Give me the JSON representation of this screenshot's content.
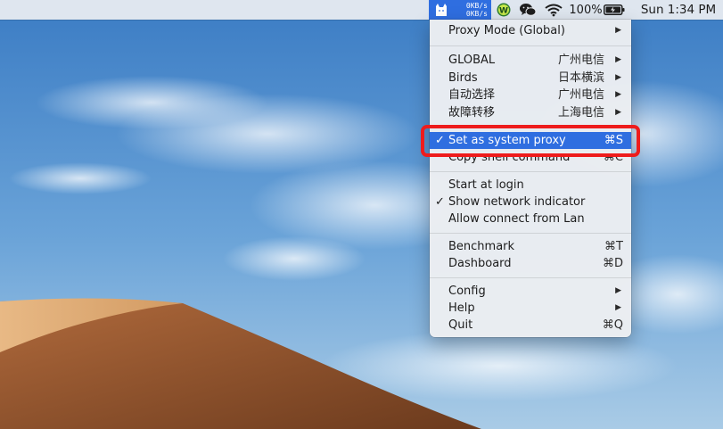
{
  "menubar": {
    "clash": {
      "speed_up": "0KB/s",
      "speed_down": "0KB/s",
      "icon": "clash-cat-icon"
    },
    "wechat_work_icon": "wechat-work-icon",
    "wechat_icon": "wechat-icon",
    "wifi_icon": "wifi-icon",
    "battery_percent": "100%",
    "battery_icon": "battery-charging-icon",
    "clock": "Sun 1:34 PM"
  },
  "menu": {
    "proxy_mode": {
      "label": "Proxy Mode (Global)"
    },
    "proxy_groups": [
      {
        "label": "GLOBAL",
        "value": "广州电信"
      },
      {
        "label": "Birds",
        "value": "日本横滨"
      },
      {
        "label": "自动选择",
        "value": "广州电信"
      },
      {
        "label": "故障转移",
        "value": "上海电信"
      }
    ],
    "set_system_proxy": {
      "label": "Set as system proxy",
      "shortcut": "⌘S",
      "checked": true
    },
    "copy_shell": {
      "label": "Copy shell command",
      "shortcut": "⌘C"
    },
    "start_at_login": {
      "label": "Start at login"
    },
    "show_network_indicator": {
      "label": "Show network indicator",
      "checked": true
    },
    "allow_lan": {
      "label": "Allow connect from Lan"
    },
    "benchmark": {
      "label": "Benchmark",
      "shortcut": "⌘T"
    },
    "dashboard": {
      "label": "Dashboard",
      "shortcut": "⌘D"
    },
    "config": {
      "label": "Config"
    },
    "help": {
      "label": "Help"
    },
    "quit": {
      "label": "Quit",
      "shortcut": "⌘Q"
    },
    "checkmark": "✓",
    "submenu_arrow": "▶"
  },
  "colors": {
    "highlight": "#2f6ee0",
    "annotation": "#ee1c1c"
  }
}
